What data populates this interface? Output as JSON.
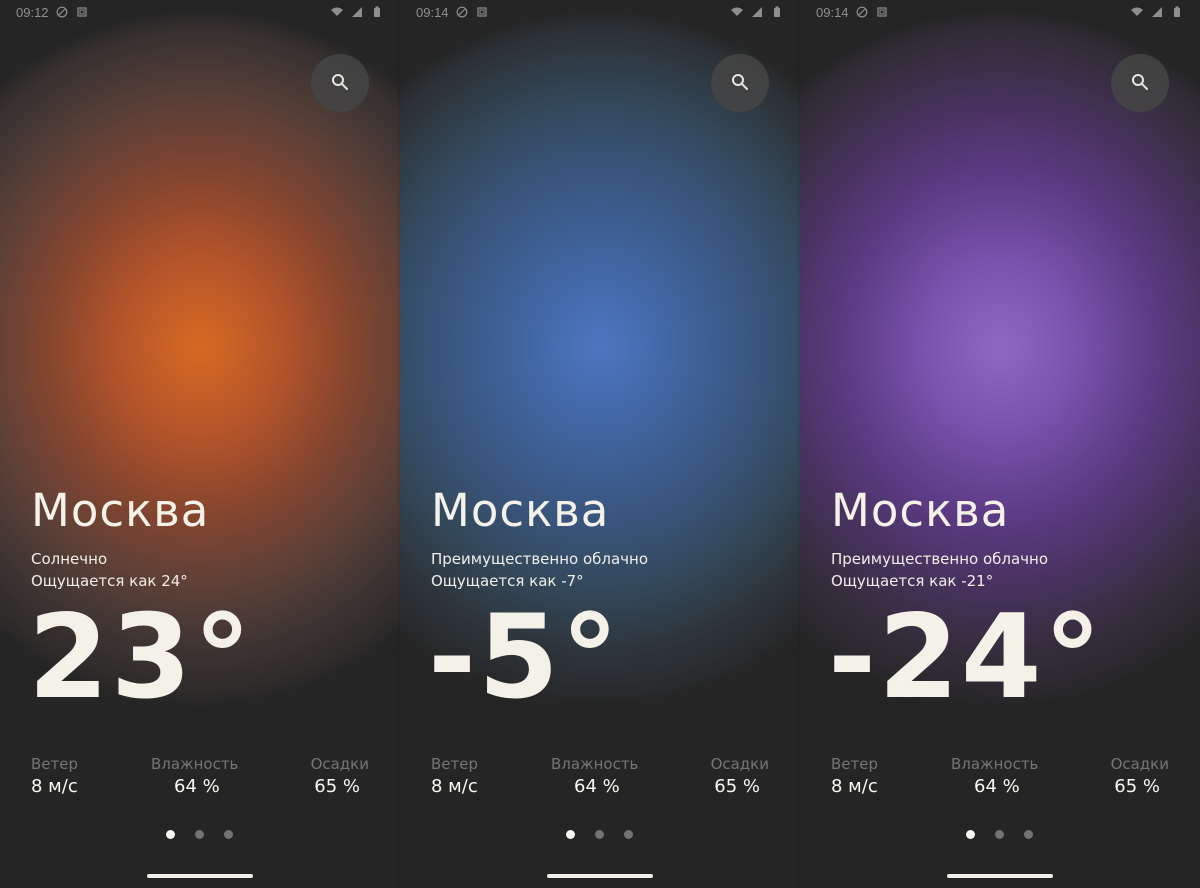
{
  "screens": [
    {
      "status_time": "09:12",
      "city": "Москва",
      "condition": "Солнечно",
      "feels_like": "Ощущается как 24°",
      "temperature": "23°",
      "accent_color": "#d76a22",
      "metrics": {
        "wind_label": "Ветер",
        "wind_value": "8 м/с",
        "humidity_label": "Влажность",
        "humidity_value": "64 %",
        "precipitation_label": "Осадки",
        "precipitation_value": "65 %"
      },
      "page_indicator_active_index": 0
    },
    {
      "status_time": "09:14",
      "city": "Москва",
      "condition": "Преимущественно облачно",
      "feels_like": "Ощущается как -7°",
      "temperature": "-5°",
      "accent_color": "#4c77c2",
      "metrics": {
        "wind_label": "Ветер",
        "wind_value": "8 м/с",
        "humidity_label": "Влажность",
        "humidity_value": "64 %",
        "precipitation_label": "Осадки",
        "precipitation_value": "65 %"
      },
      "page_indicator_active_index": 0
    },
    {
      "status_time": "09:14",
      "city": "Москва",
      "condition": "Преимущественно облачно",
      "feels_like": "Ощущается как -21°",
      "temperature": "-24°",
      "accent_color": "#8f68c3",
      "metrics": {
        "wind_label": "Ветер",
        "wind_value": "8 м/с",
        "humidity_label": "Влажность",
        "humidity_value": "64 %",
        "precipitation_label": "Осадки",
        "precipitation_value": "65 %"
      },
      "page_indicator_active_index": 0
    }
  ],
  "icons": {
    "search": "search-icon",
    "dnd": "do-not-disturb-icon",
    "screenshot": "screenshot-icon",
    "wifi": "wifi-icon",
    "signal": "signal-icon",
    "battery": "battery-icon"
  }
}
